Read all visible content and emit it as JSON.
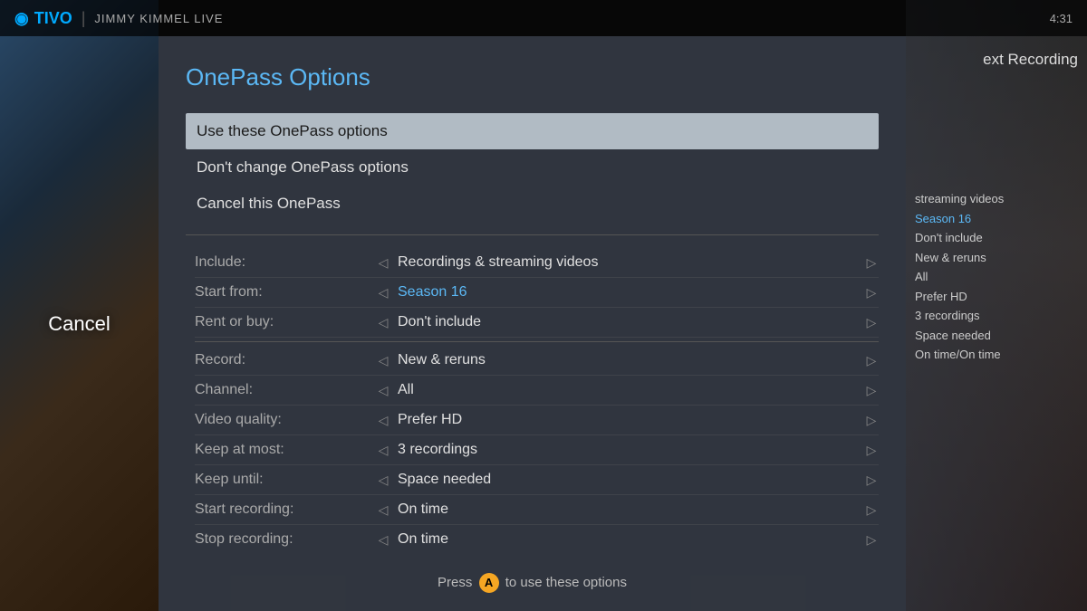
{
  "app": {
    "logo": "TIVO",
    "logo_icon": "◉",
    "divider": "|",
    "show_name": "JIMMY KIMMEL LIVE",
    "time": "4:31"
  },
  "dialog": {
    "title": "OnePass Options",
    "menu_items": [
      {
        "label": "Use these OnePass options",
        "selected": true
      },
      {
        "label": "Don't change OnePass options",
        "selected": false
      },
      {
        "label": "Cancel this OnePass",
        "selected": false
      }
    ],
    "options": [
      {
        "group": 1,
        "rows": [
          {
            "label": "Include:",
            "value": "Recordings & streaming videos",
            "blue": false
          },
          {
            "label": "Start from:",
            "value": "Season 16",
            "blue": true
          },
          {
            "label": "Rent or buy:",
            "value": "Don't include",
            "blue": false
          }
        ]
      },
      {
        "group": 2,
        "rows": [
          {
            "label": "Record:",
            "value": "New & reruns",
            "blue": false
          },
          {
            "label": "Channel:",
            "value": "All",
            "blue": false
          },
          {
            "label": "Video quality:",
            "value": "Prefer HD",
            "blue": false
          },
          {
            "label": "Keep at most:",
            "value": "3 recordings",
            "blue": false
          },
          {
            "label": "Keep until:",
            "value": "Space needed",
            "blue": false
          },
          {
            "label": "Start recording:",
            "value": "On time",
            "blue": false
          },
          {
            "label": "Stop recording:",
            "value": "On time",
            "blue": false
          }
        ]
      }
    ],
    "footer": {
      "prefix": "Press",
      "button_label": "A",
      "suffix": "to use these options"
    }
  },
  "left_panel": {
    "cancel_label": "Cancel"
  },
  "right_panel": {
    "next_recording": "ext Recording",
    "items": [
      {
        "label": "streaming videos",
        "blue": false
      },
      {
        "label": "Season 16",
        "blue": true
      },
      {
        "label": "Don't include",
        "blue": false
      },
      {
        "label": "New & reruns",
        "blue": false
      },
      {
        "label": "All",
        "blue": false
      },
      {
        "label": "Prefer HD",
        "blue": false
      },
      {
        "label": "3 recordings",
        "blue": false
      },
      {
        "label": "Space needed",
        "blue": false
      },
      {
        "label": "On time/On time",
        "blue": false
      }
    ]
  }
}
